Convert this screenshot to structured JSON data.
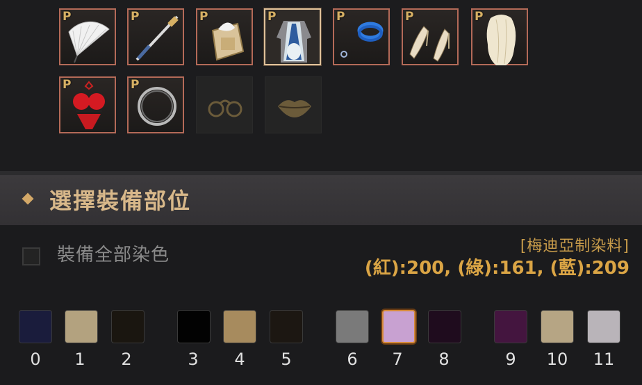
{
  "equipment": {
    "slots": [
      {
        "name": "fan-icon",
        "badge": "P"
      },
      {
        "name": "sword-icon",
        "badge": "P"
      },
      {
        "name": "scroll-book-icon",
        "badge": "P"
      },
      {
        "name": "costume-outfit-icon",
        "badge": "P",
        "selected": true
      },
      {
        "name": "blue-bracelet-icon",
        "badge": "P"
      },
      {
        "name": "heels-icon",
        "badge": "P"
      },
      {
        "name": "wig-hair-icon",
        "badge": "P"
      },
      {
        "name": "red-lingerie-icon",
        "badge": "P"
      },
      {
        "name": "ring-icon",
        "badge": "P"
      },
      {
        "name": "glasses-icon",
        "badge": "",
        "empty": true
      },
      {
        "name": "lips-icon",
        "badge": "",
        "empty": true
      }
    ]
  },
  "header": {
    "title": "選擇裝備部位"
  },
  "dye_all": {
    "label": "裝備全部染色",
    "checked": false
  },
  "dye": {
    "name": "[梅迪亞制染料]",
    "rgb_text": "(紅):200, (綠):161, (藍):209",
    "r": 200,
    "g": 161,
    "b": 209
  },
  "palette": [
    {
      "label": "0",
      "color": "#1a1c3c"
    },
    {
      "label": "1",
      "color": "#b3a27f"
    },
    {
      "label": "2",
      "color": "#1a1610"
    },
    {
      "label": "3",
      "color": "#020202"
    },
    {
      "label": "4",
      "color": "#a78b5e"
    },
    {
      "label": "5",
      "color": "#1c1712"
    },
    {
      "label": "6",
      "color": "#7a7a7a"
    },
    {
      "label": "7",
      "color": "#c8a1d1",
      "selected": true
    },
    {
      "label": "8",
      "color": "#1f0c1e"
    },
    {
      "label": "9",
      "color": "#44153f"
    },
    {
      "label": "10",
      "color": "#b6a584"
    },
    {
      "label": "11",
      "color": "#b9b4b9"
    }
  ],
  "colors": {
    "accent": "#d3a868",
    "border": "#b46a58",
    "dye_text": "#dba545"
  }
}
